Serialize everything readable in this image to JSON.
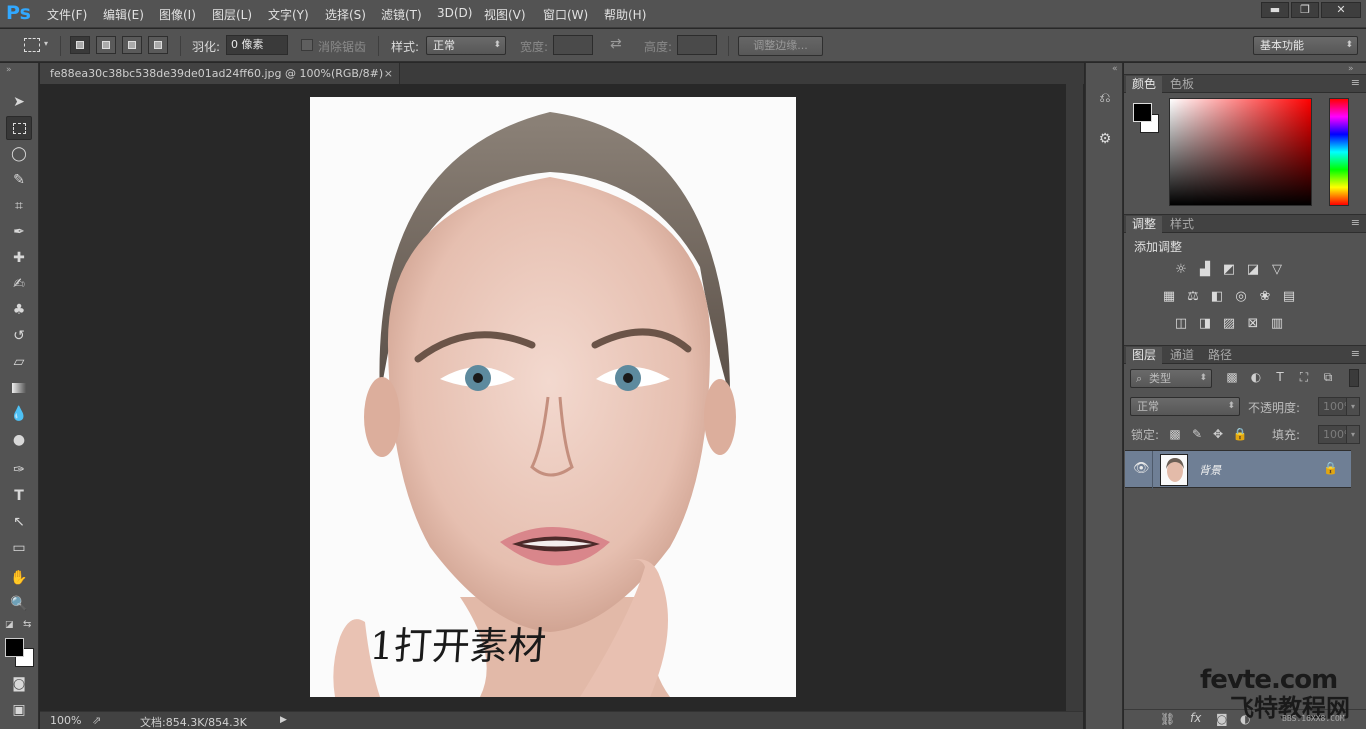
{
  "app": {
    "logo": "Ps"
  },
  "menu": [
    "文件(F)",
    "编辑(E)",
    "图像(I)",
    "图层(L)",
    "文字(Y)",
    "选择(S)",
    "滤镜(T)",
    "3D(D)",
    "视图(V)",
    "窗口(W)",
    "帮助(H)"
  ],
  "window_controls": {
    "minimize": "▬",
    "restore": "❐",
    "close": "✕"
  },
  "options": {
    "feather_label": "羽化:",
    "feather_value": "0 像素",
    "antialias_label": "消除锯齿",
    "style_label": "样式:",
    "style_value": "正常",
    "width_label": "宽度:",
    "height_label": "高度:",
    "refine_edge_button": "调整边缘...",
    "workspace": "基本功能"
  },
  "document": {
    "tab_title": "fe88ea30c38bc538de39de01ad24ff60.jpg @ 100%(RGB/8#)",
    "tab_close": "×",
    "photo_caption": "1打开素材"
  },
  "status": {
    "zoom": "100%",
    "doc_info": "文档:854.3K/854.3K"
  },
  "panels": {
    "color_tabs": [
      "颜色",
      "色板"
    ],
    "adjust_tabs": [
      "调整",
      "样式"
    ],
    "add_adjustment": "添加调整",
    "layers_tabs": [
      "图层",
      "通道",
      "路径"
    ],
    "filter_kind": "类型",
    "blend_mode": "正常",
    "opacity_label": "不透明度:",
    "opacity_value": "100%",
    "lock_label": "锁定:",
    "fill_label": "填充:",
    "fill_value": "100%",
    "layer_name": "背景"
  },
  "watermark": {
    "line1": "fevte.com",
    "line2": "飞特教程网",
    "line3": "BBS.16XX8.COM"
  },
  "colors": {
    "foreground": "#000000",
    "background": "#ffffff",
    "selected_layer": "#6f7f95",
    "ps_blue": "#31a8ff"
  }
}
